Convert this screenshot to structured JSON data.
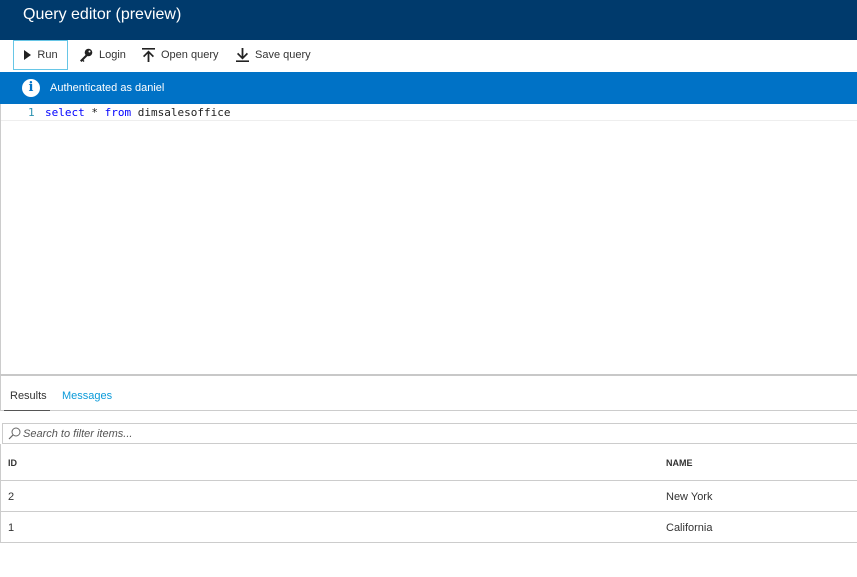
{
  "window": {
    "title": "Query editor (preview)"
  },
  "toolbar": {
    "run_label": "Run",
    "login_label": "Login",
    "open_label": "Open query",
    "save_label": "Save query"
  },
  "banner": {
    "text": "Authenticated as daniel",
    "icon": "info-icon"
  },
  "editor": {
    "line_number": "1",
    "tokens": {
      "kw1": "select",
      "star": " * ",
      "kw2": "from",
      "rest": " dimsalesoffice"
    }
  },
  "tabs": {
    "results": "Results",
    "messages": "Messages"
  },
  "filter": {
    "placeholder": "Search to filter items..."
  },
  "grid": {
    "columns": [
      "ID",
      "NAME"
    ],
    "rows": [
      {
        "id": "2",
        "name": "New York"
      },
      {
        "id": "1",
        "name": "California"
      }
    ]
  },
  "colors": {
    "titlebar": "#003a6c",
    "banner": "#0072c6",
    "accent": "#0a9ad9"
  }
}
